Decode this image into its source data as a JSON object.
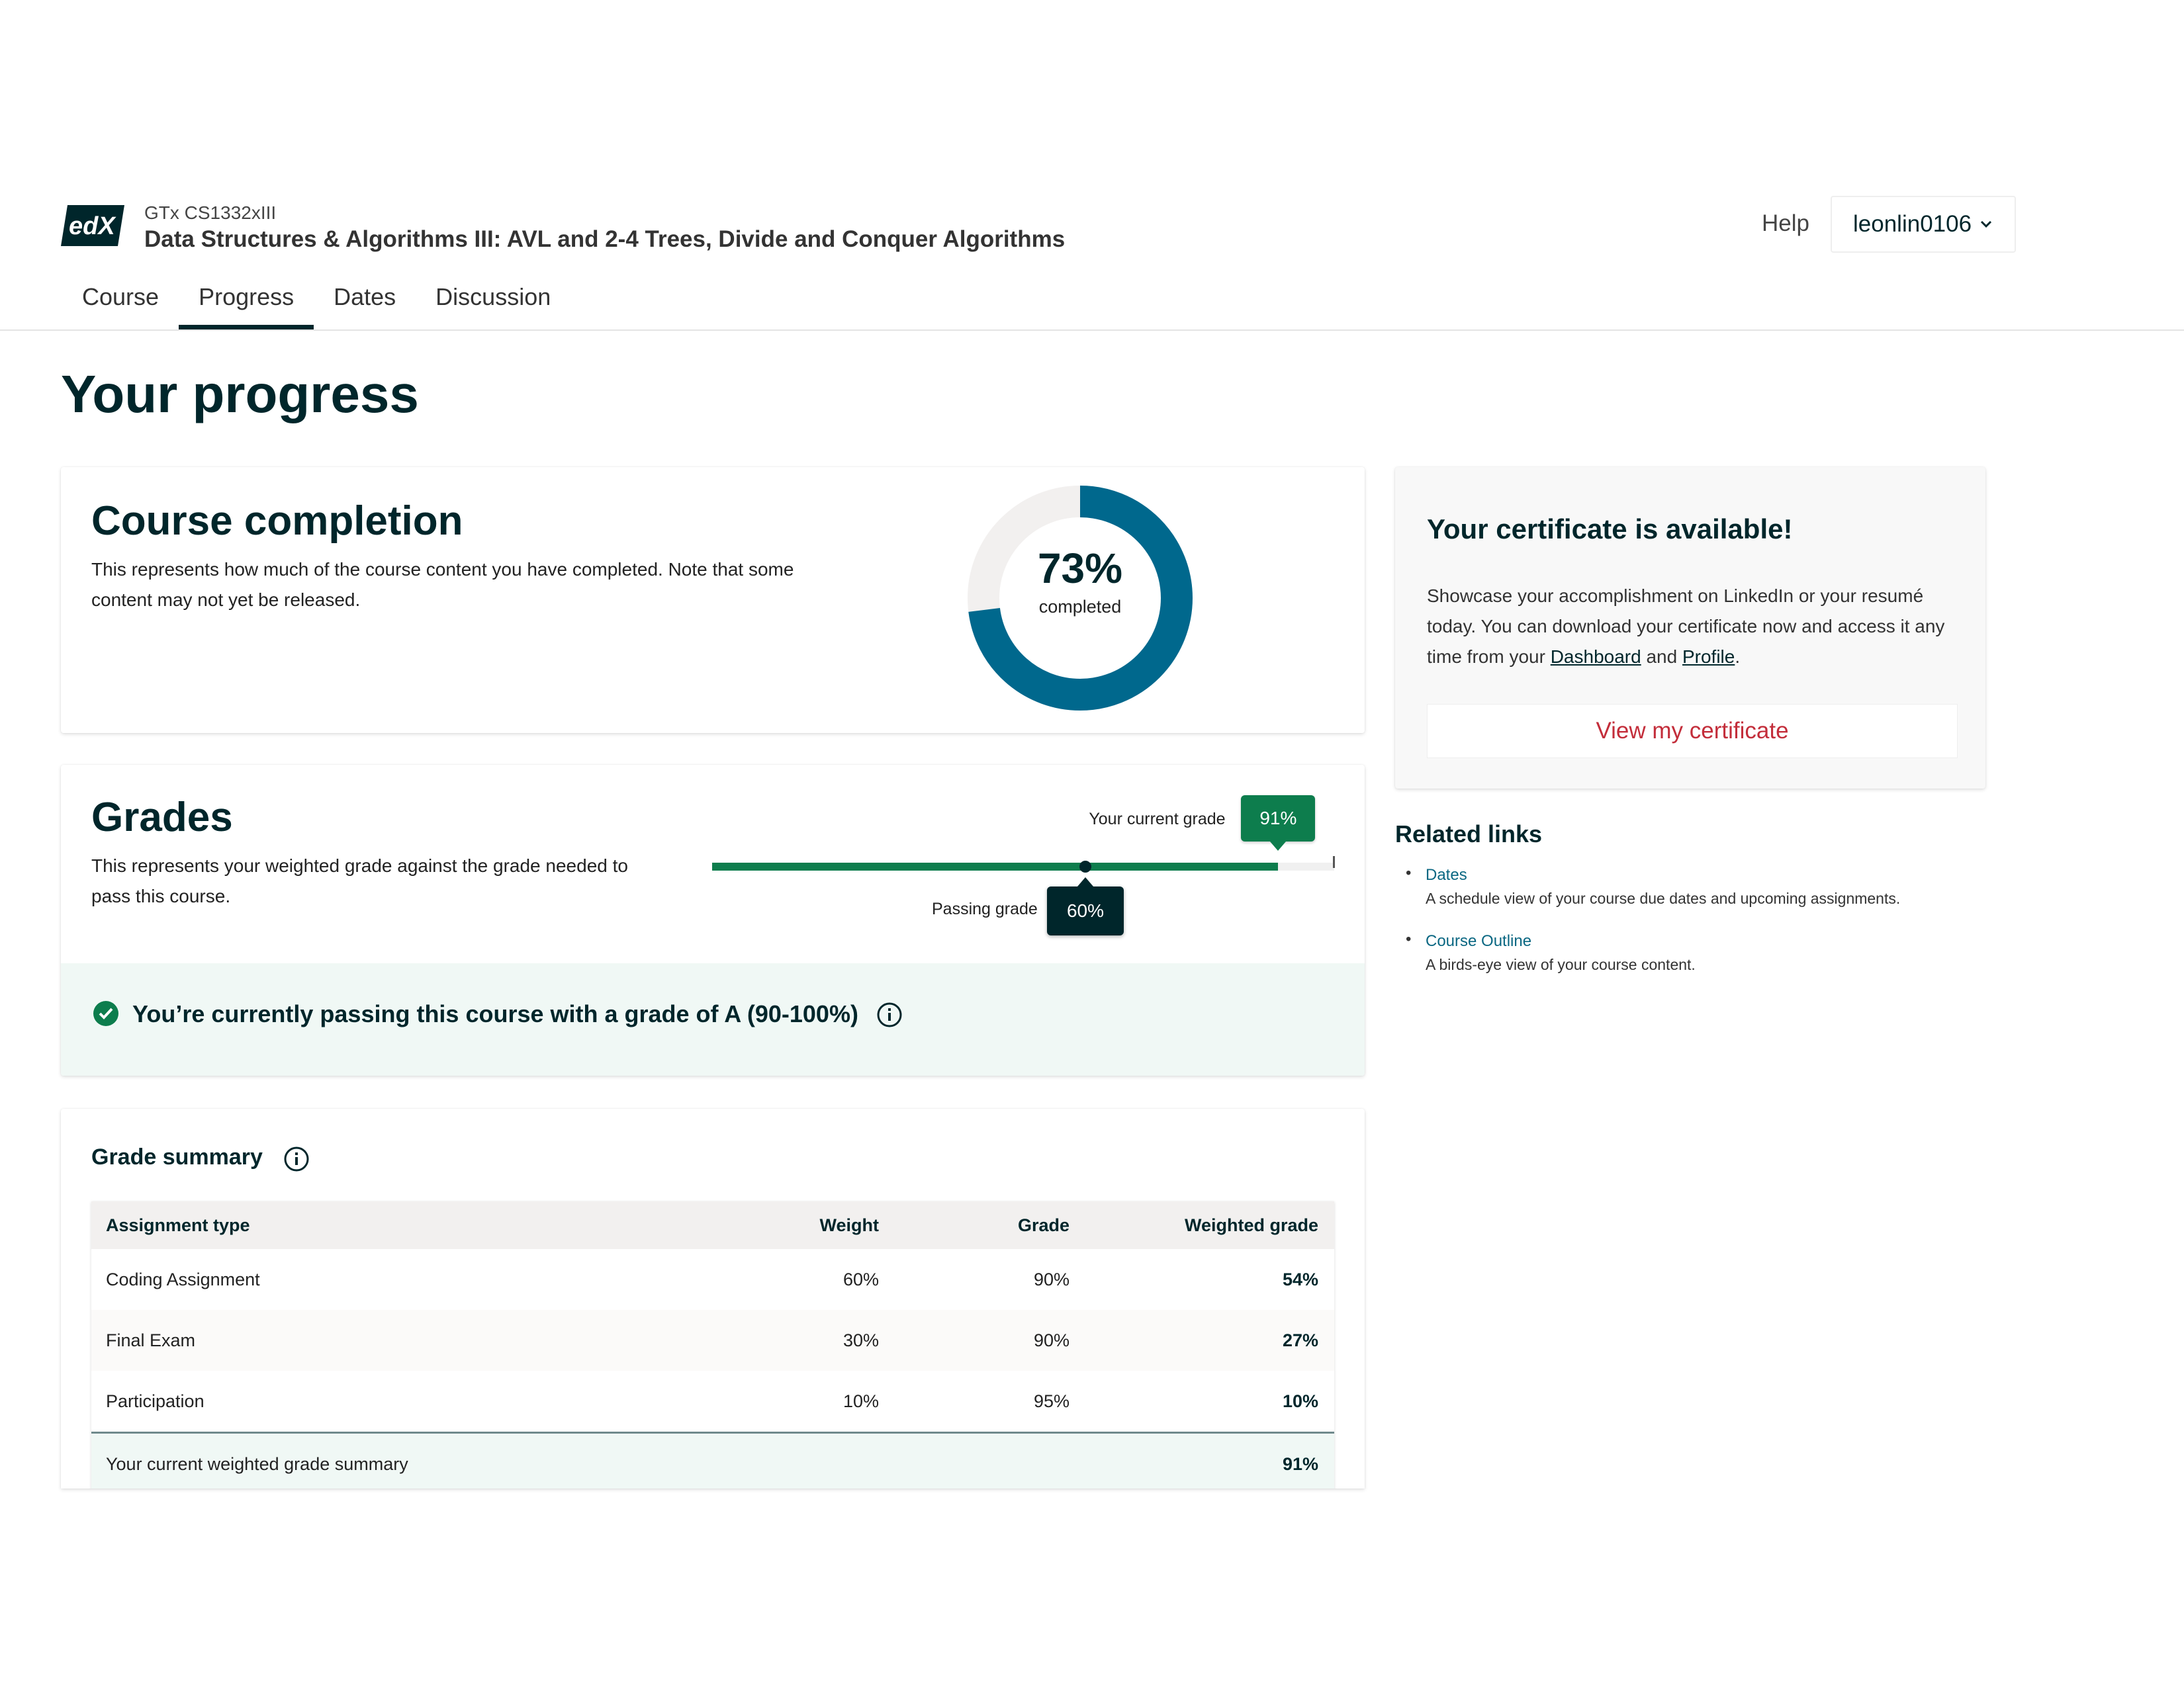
{
  "header": {
    "course_org": "GTx CS1332xIII",
    "course_title": "Data Structures & Algorithms III: AVL and 2-4 Trees, Divide and Conquer Algorithms",
    "logo_text": "edX",
    "help_label": "Help",
    "username": "leonlin0106"
  },
  "tabs": [
    {
      "label": "Course",
      "active": false
    },
    {
      "label": "Progress",
      "active": true
    },
    {
      "label": "Dates",
      "active": false
    },
    {
      "label": "Discussion",
      "active": false
    }
  ],
  "page_title": "Your progress",
  "completion": {
    "title": "Course completion",
    "description": "This represents how much of the course content you have completed. Note that some content may not yet be released.",
    "percent": 73,
    "percent_label": "73%",
    "caption": "completed",
    "color_done": "#00688d",
    "color_remaining": "#f2f0ef"
  },
  "grades": {
    "title": "Grades",
    "description": "This represents your weighted grade against the grade needed to pass this course.",
    "current_label": "Your current grade",
    "current_value": "91%",
    "current_fraction": 0.91,
    "passing_label": "Passing grade",
    "passing_value": "60%",
    "passing_fraction": 0.6,
    "status_text": "You’re currently passing this course with a grade of A (90-100%)",
    "accent": "#0d7d4d"
  },
  "summary": {
    "title": "Grade summary",
    "columns": [
      "Assignment type",
      "Weight",
      "Grade",
      "Weighted grade"
    ],
    "rows": [
      [
        "Coding Assignment",
        "60%",
        "90%",
        "54%"
      ],
      [
        "Final Exam",
        "30%",
        "90%",
        "27%"
      ],
      [
        "Participation",
        "10%",
        "95%",
        "10%"
      ]
    ],
    "total_label": "Your current weighted grade summary",
    "total_value": "91%"
  },
  "certificate": {
    "title": "Your certificate is available!",
    "text_before": "Showcase your accomplishment on LinkedIn or your resumé today. You can download your certificate now and access it any time from your ",
    "dashboard_link": "Dashboard",
    "text_and": " and ",
    "profile_link": "Profile",
    "text_end": ".",
    "button_label": "View my certificate"
  },
  "related": {
    "title": "Related links",
    "items": [
      {
        "label": "Dates",
        "description": "A schedule view of your course due dates and upcoming assignments."
      },
      {
        "label": "Course Outline",
        "description": "A birds-eye view of your course content."
      }
    ]
  }
}
